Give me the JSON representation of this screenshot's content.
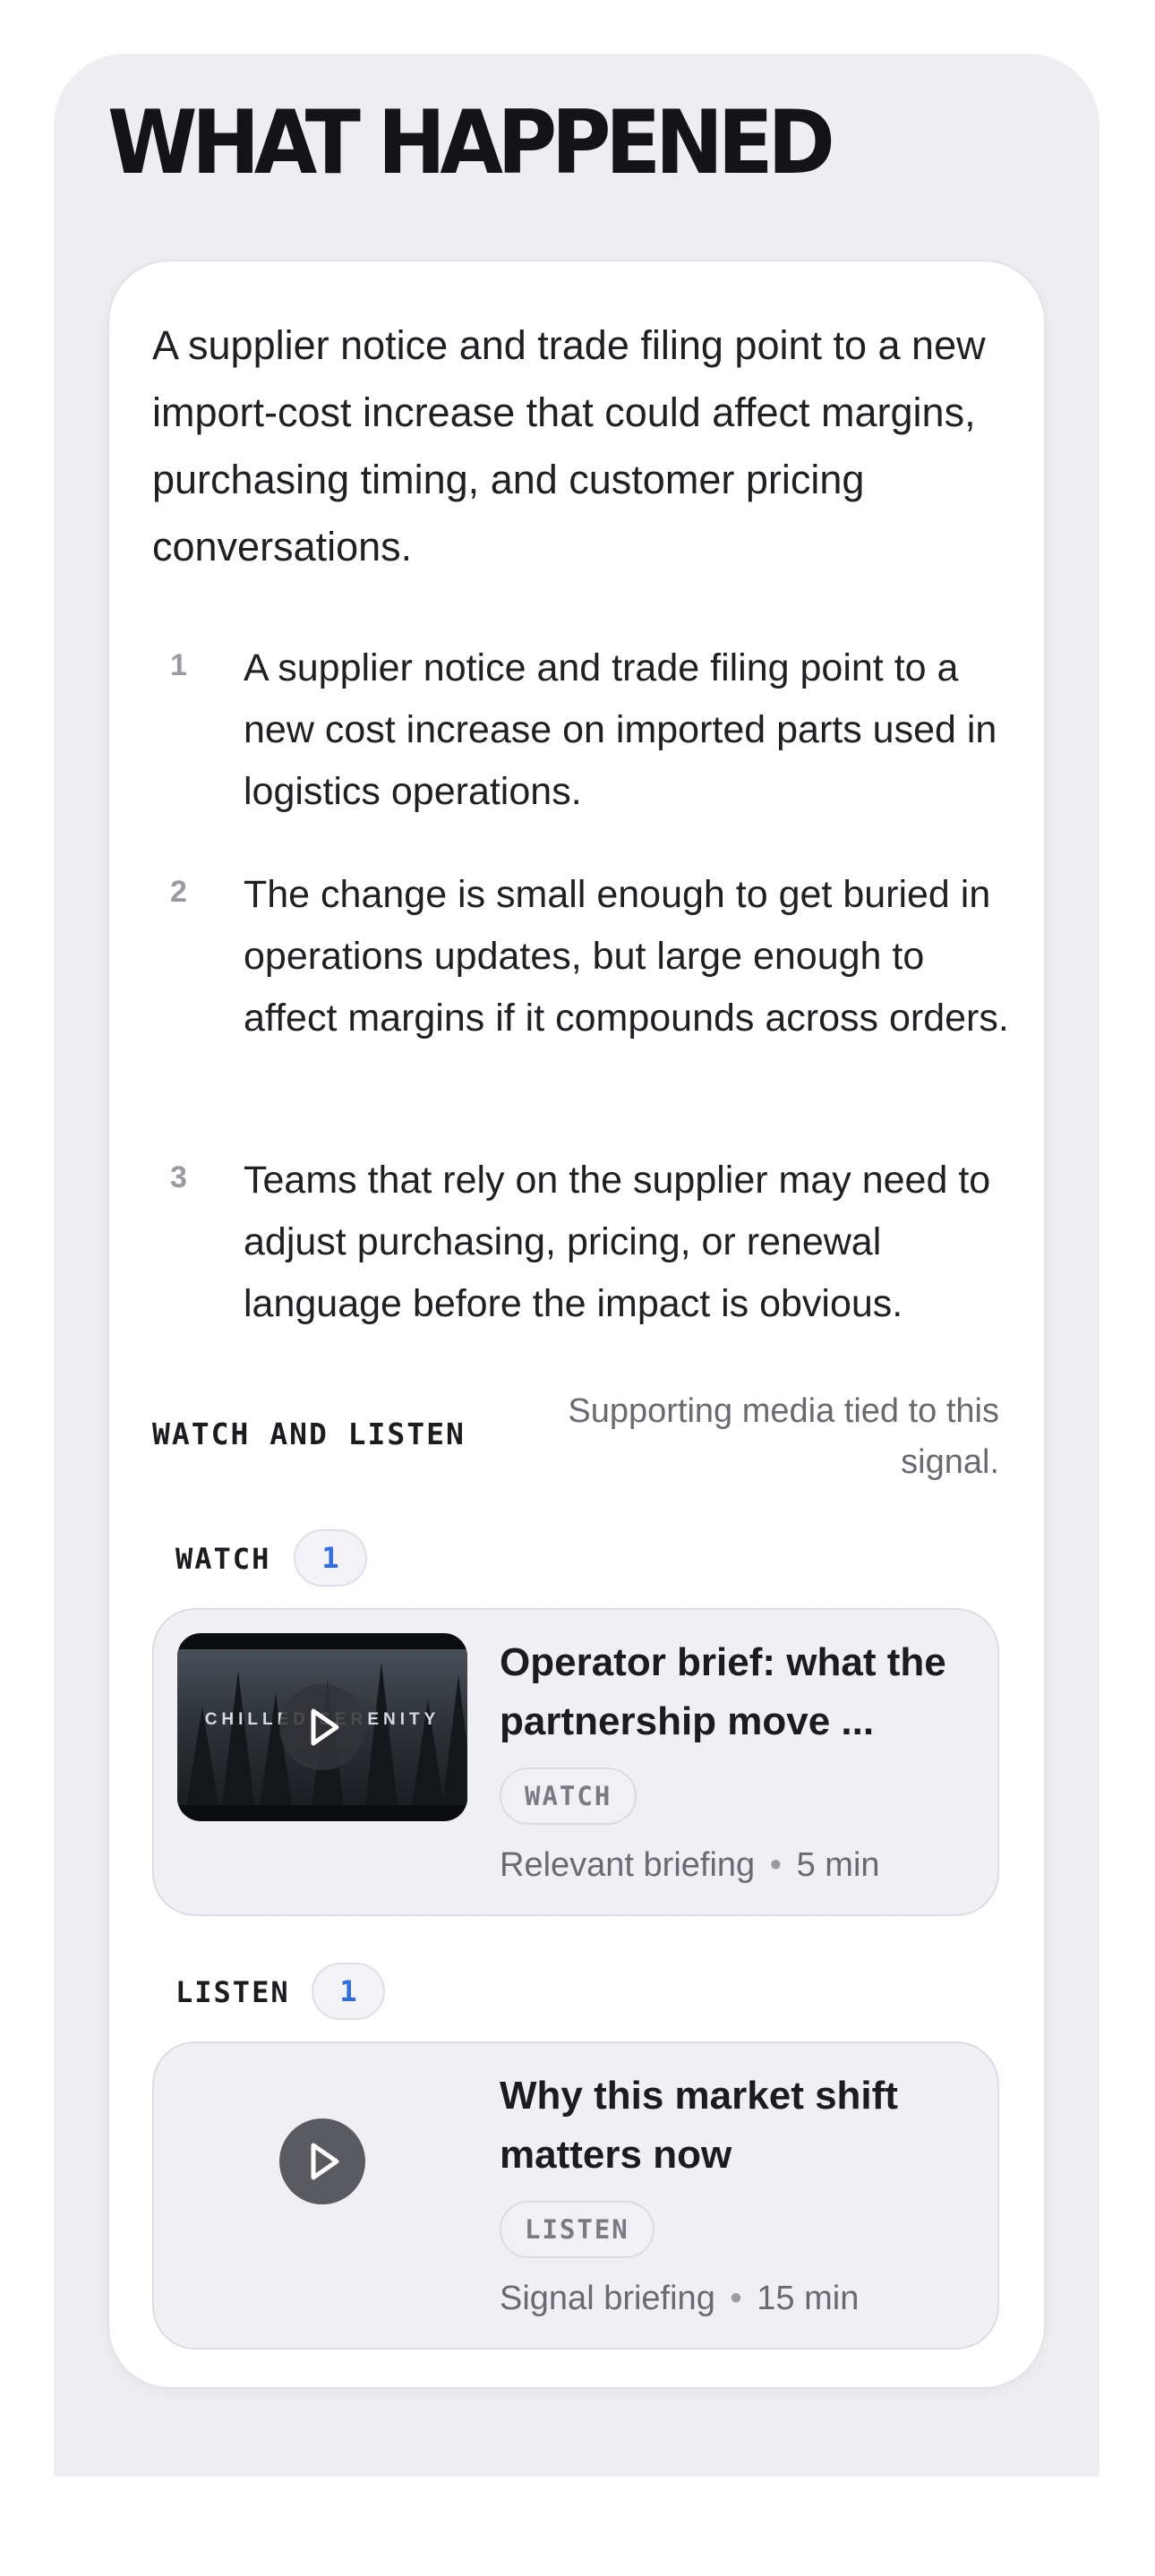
{
  "section": {
    "title": "WHAT HAPPENED",
    "summary": "A supplier notice and trade filing point to a new import-cost increase that could affect margins, purchasing timing, and customer pricing conversations."
  },
  "points": [
    {
      "number": "1",
      "text": "A supplier notice and trade filing point to a new cost increase on imported parts used in logistics operations."
    },
    {
      "number": "2",
      "text": "The change is small enough to get buried in operations updates, but large enough to affect margins if it compounds across orders."
    },
    {
      "number": "3",
      "text": "Teams that rely on the supplier may need to adjust purchasing, pricing, or renewal language before the impact is obvious."
    }
  ],
  "media": {
    "heading": "WATCH AND LISTEN",
    "subheading": "Supporting media tied to this signal.",
    "watch": {
      "label": "WATCH",
      "count": "1",
      "item": {
        "thumbnail_text": "CHILLED SERENITY",
        "title": "Operator brief: what the partnership move ...",
        "badge": "WATCH",
        "source": "Relevant briefing",
        "separator": "•",
        "duration": "5 min"
      }
    },
    "listen": {
      "label": "LISTEN",
      "count": "1",
      "item": {
        "title": "Why this market shift matters now",
        "badge": "LISTEN",
        "source": "Signal briefing",
        "separator": "•",
        "duration": "15 min"
      }
    }
  },
  "icons": {
    "video_play": "play-icon",
    "audio_play": "play-icon"
  },
  "colors": {
    "accent": "#2f6fe0",
    "panel_bg": "#ededf2",
    "card_bg": "#ffffff",
    "media_card_bg": "#efeff4"
  }
}
